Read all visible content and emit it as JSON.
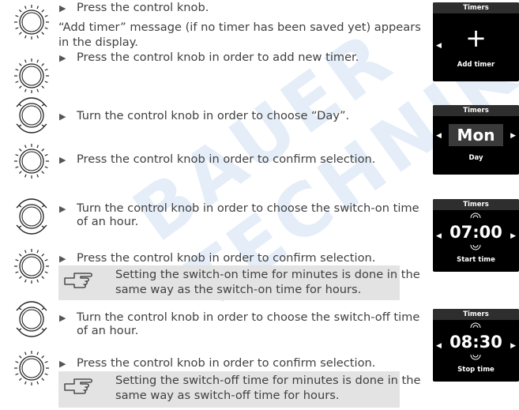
{
  "watermark": "BAUER TECHNIK",
  "steps": [
    {
      "text": "Press the control knob."
    },
    {
      "text": "“Add timer” message (if no timer has been saved yet) appears"
    },
    {
      "text": "in the display."
    },
    {
      "text": "Press the control knob in order to add new timer."
    },
    {
      "text": "Turn the control knob in order to choose “Day”."
    },
    {
      "text": "Press the control knob in order to confirm selection."
    },
    {
      "text": "Turn the control knob in order to choose the switch-on time"
    },
    {
      "text": "of an hour."
    },
    {
      "text": "Press the control knob in order to confirm selection."
    },
    {
      "text": "Turn the control knob in order to choose the switch-off time"
    },
    {
      "text": "of an hour."
    },
    {
      "text": "Press the control knob in order to confirm selection."
    }
  ],
  "notes": [
    {
      "line1": "Setting the switch-on time for minutes is done in the",
      "line2": "same way as the switch-on time for hours."
    },
    {
      "line1": "Setting the switch-off time for minutes is done in the",
      "line2": "same way as switch-off time for hours."
    }
  ],
  "screens": [
    {
      "header": "Timers",
      "value": "+",
      "caption": "Add timer"
    },
    {
      "header": "Timers",
      "value": "Mon",
      "caption": "Day"
    },
    {
      "header": "Timers",
      "value": "07:00",
      "caption": "Start time"
    },
    {
      "header": "Timers",
      "value": "08:30",
      "caption": "Stop time"
    }
  ],
  "icons": {
    "press_knob": "knob-press-icon",
    "turn_knob": "knob-turn-icon",
    "note": "pointing-hand-icon",
    "bullet": "triangle-bullet-icon"
  }
}
